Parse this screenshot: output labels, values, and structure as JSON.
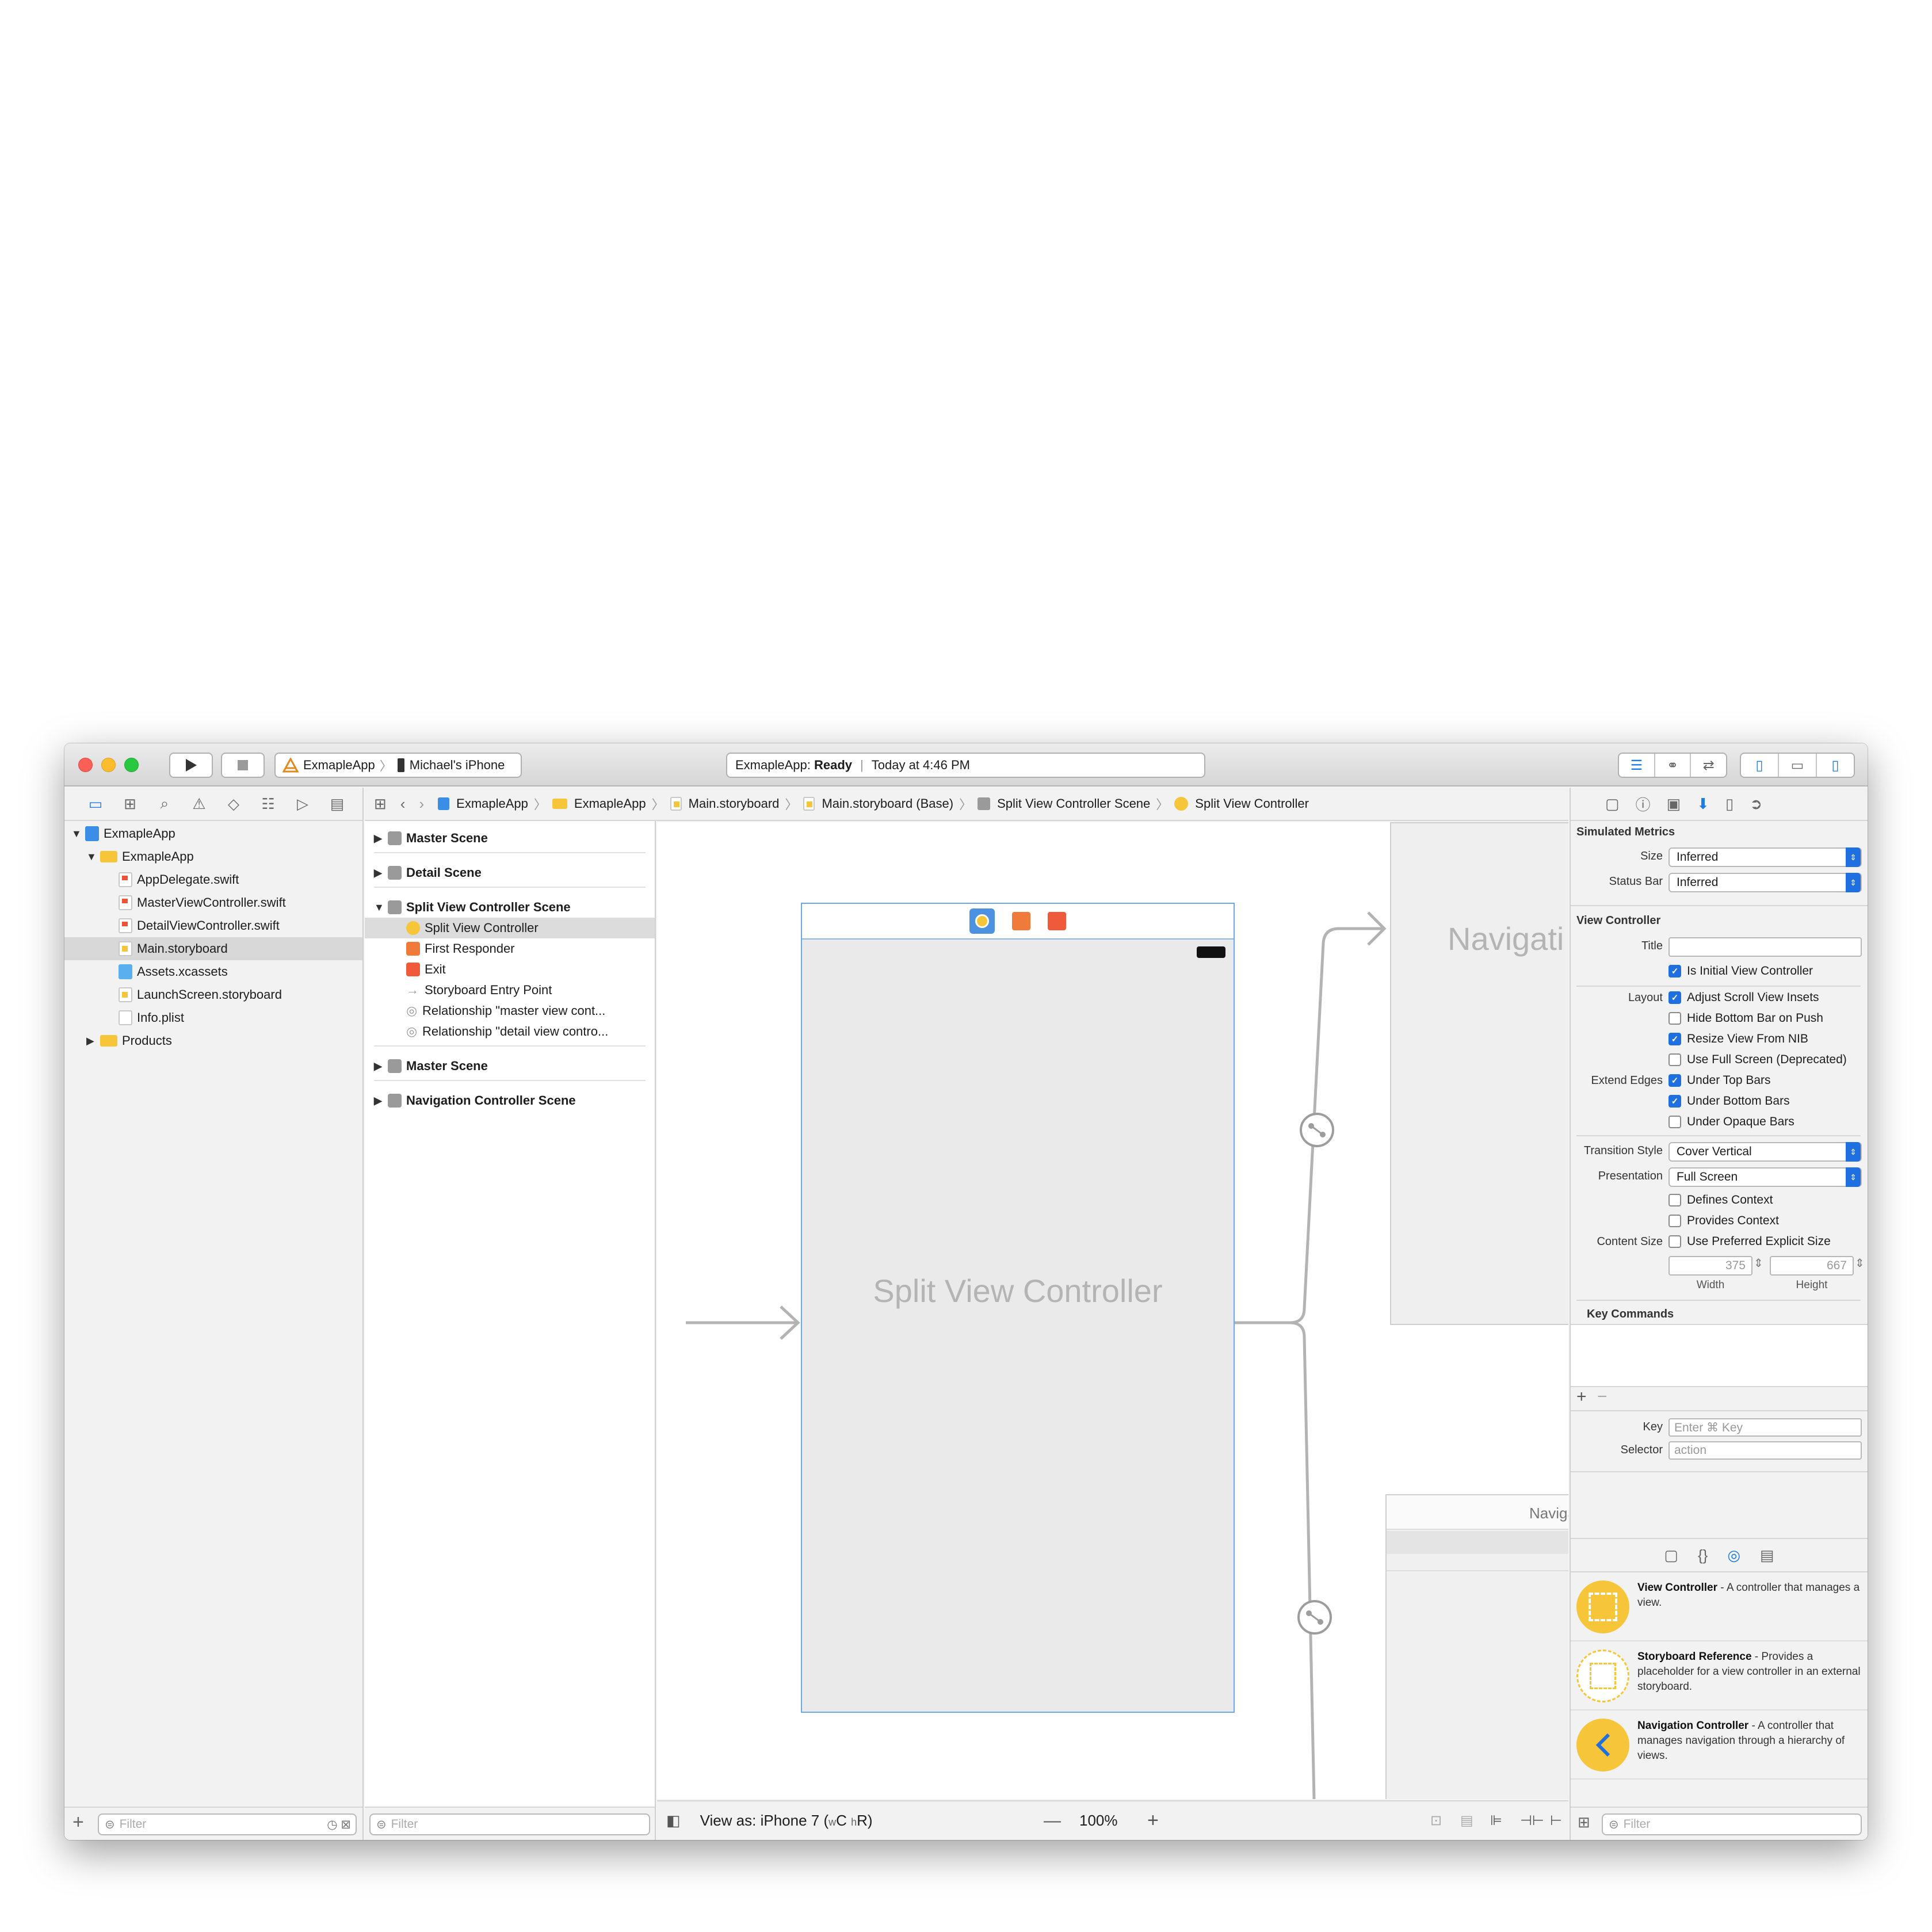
{
  "toolbar": {
    "scheme_app": "ExmapleApp",
    "scheme_device": "Michael's iPhone",
    "activity_app": "ExmapleApp:",
    "activity_status": "Ready",
    "activity_time": "Today at 4:46 PM"
  },
  "navigator": {
    "items": [
      {
        "label": "ExmapleApp",
        "icon": "project-icon"
      },
      {
        "label": "ExmapleApp",
        "icon": "folder-icon"
      },
      {
        "label": "AppDelegate.swift",
        "icon": "swift-file-icon"
      },
      {
        "label": "MasterViewController.swift",
        "icon": "swift-file-icon"
      },
      {
        "label": "DetailViewController.swift",
        "icon": "swift-file-icon"
      },
      {
        "label": "Main.storyboard",
        "icon": "storyboard-file-icon"
      },
      {
        "label": "Assets.xcassets",
        "icon": "assets-folder-icon"
      },
      {
        "label": "LaunchScreen.storyboard",
        "icon": "storyboard-file-icon"
      },
      {
        "label": "Info.plist",
        "icon": "plist-file-icon"
      },
      {
        "label": "Products",
        "icon": "folder-icon"
      }
    ],
    "filter_placeholder": "Filter"
  },
  "jumpbar": {
    "items": [
      "ExmapleApp",
      "ExmapleApp",
      "Main.storyboard",
      "Main.storyboard (Base)",
      "Split View Controller Scene",
      "Split View Controller"
    ]
  },
  "outline": {
    "scene_master_1": "Master Scene",
    "scene_detail": "Detail Scene",
    "scene_split": "Split View Controller Scene",
    "split_children": [
      "Split View Controller",
      "First Responder",
      "Exit",
      "Storyboard Entry Point",
      "Relationship \"master view cont...",
      "Relationship \"detail view contro..."
    ],
    "scene_master_2": "Master Scene",
    "scene_nav": "Navigation Controller Scene",
    "filter_placeholder": "Filter"
  },
  "canvas": {
    "split_title": "Split View Controller",
    "nav_title_1": "Navigati",
    "nav_title_2": "Naviga",
    "view_as": "View as: iPhone 7 (",
    "view_as_w": "w",
    "view_as_c": "C",
    "view_as_h": "h",
    "view_as_r": "R)",
    "zoom": "100%"
  },
  "inspector": {
    "simulated_metrics": "Simulated Metrics",
    "size_label": "Size",
    "size_value": "Inferred",
    "status_bar_label": "Status Bar",
    "status_bar_value": "Inferred",
    "view_controller": "View Controller",
    "title_label": "Title",
    "is_initial": "Is Initial View Controller",
    "layout_label": "Layout",
    "adjust_scroll": "Adjust Scroll View Insets",
    "hide_bottom": "Hide Bottom Bar on Push",
    "resize_nib": "Resize View From NIB",
    "full_screen": "Use Full Screen (Deprecated)",
    "extend_label": "Extend Edges",
    "under_top": "Under Top Bars",
    "under_bottom": "Under Bottom Bars",
    "under_opaque": "Under Opaque Bars",
    "transition_label": "Transition Style",
    "transition_value": "Cover Vertical",
    "presentation_label": "Presentation",
    "presentation_value": "Full Screen",
    "defines_context": "Defines Context",
    "provides_context": "Provides Context",
    "content_size_label": "Content Size",
    "preferred_explicit": "Use Preferred Explicit Size",
    "width_value": "375",
    "height_value": "667",
    "width_label": "Width",
    "height_label": "Height",
    "key_commands": "Key Commands",
    "key_label": "Key",
    "key_placeholder": "Enter ⌘ Key",
    "selector_label": "Selector",
    "selector_placeholder": "action"
  },
  "library": {
    "items": [
      {
        "name": "View Controller",
        "desc": " - A controller that manages a view."
      },
      {
        "name": "Storyboard Reference",
        "desc": " - Provides a placeholder for a view controller in an external storyboard."
      },
      {
        "name": "Navigation Controller",
        "desc": " - A controller that manages navigation through a hierarchy of views."
      }
    ],
    "filter_placeholder": "Filter"
  },
  "colors": {
    "accent": "#1f7ce3",
    "selection": "#d8d8d8",
    "library_yellow": "#f7c53a"
  }
}
